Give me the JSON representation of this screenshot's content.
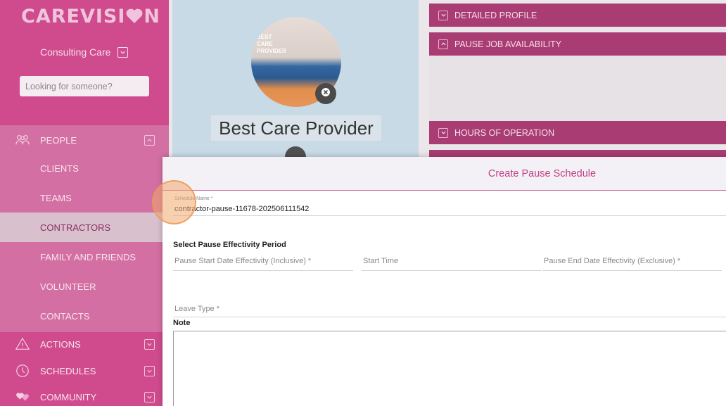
{
  "app": {
    "logo_text": "CAREVISI",
    "logo_suffix": "N",
    "org_name": "Consulting Care",
    "search_placeholder": "Looking for someone?"
  },
  "nav": {
    "people": "PEOPLE",
    "clients": "CLIENTS",
    "teams": "TEAMS",
    "contractors": "CONTRACTORS",
    "family": "FAMILY AND FRIENDS",
    "volunteer": "VOLUNTEER",
    "contacts": "CONTACTS",
    "actions": "ACTIONS",
    "schedules": "SCHEDULES",
    "community": "COMMUNITY"
  },
  "profile": {
    "name": "Best Care Provider",
    "avatar_caption_1": "BEST",
    "avatar_caption_2": "CARE",
    "avatar_caption_3": "PROVIDER"
  },
  "sections": {
    "detailed_profile": "DETAILED PROFILE",
    "pause_job": "PAUSE JOB AVAILABILITY",
    "hours": "HOURS OF OPERATION"
  },
  "modal": {
    "title": "Create Pause Schedule",
    "schedule_name_label": "Schedule Name *",
    "schedule_name_value": "contractor-pause-11678-202506111542",
    "period_heading": "Select Pause Effectivity Period",
    "start_date_placeholder": "Pause Start Date Effectivity (Inclusive) *",
    "start_time_placeholder": "Start Time",
    "end_date_placeholder": "Pause End Date Effectivity (Exclusive) *",
    "leave_type_placeholder": "Leave Type *",
    "note_label": "Note"
  },
  "colors": {
    "sidebar": "#cf4b8e",
    "section_bar": "#a93d73",
    "accent": "#c23f85"
  }
}
